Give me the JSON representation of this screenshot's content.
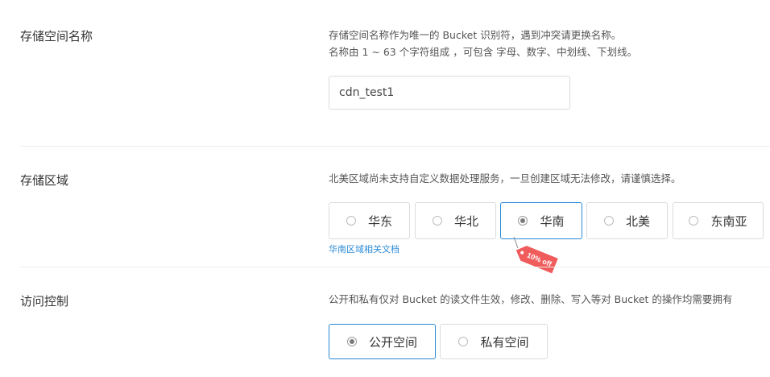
{
  "bucket_name": {
    "label": "存储空间名称",
    "desc_line1": "存储空间名称作为唯一的 Bucket 识别符，遇到冲突请更换名称。",
    "desc_line2": "名称由 1 ~ 63 个字符组成 ，可包含 字母、数字、中划线、下划线。",
    "value": "cdn_test1"
  },
  "region": {
    "label": "存储区域",
    "desc": "北美区域尚未支持自定义数据处理服务，一旦创建区域无法修改，请谨慎选择。",
    "options": [
      {
        "label": "华东",
        "selected": false
      },
      {
        "label": "华北",
        "selected": false
      },
      {
        "label": "华南",
        "selected": true
      },
      {
        "label": "北美",
        "selected": false
      },
      {
        "label": "东南亚",
        "selected": false
      }
    ],
    "doc_link": "华南区域相关文档",
    "promo": "10% off"
  },
  "access": {
    "label": "访问控制",
    "desc": "公开和私有仅对 Bucket 的读文件生效，修改、删除、写入等对 Bucket 的操作均需要拥有",
    "options": [
      {
        "label": "公开空间",
        "selected": true
      },
      {
        "label": "私有空间",
        "selected": false
      }
    ]
  },
  "colors": {
    "accent": "#2b8ad6",
    "promo": "#f05b5b",
    "divider": "#eeeeee"
  }
}
